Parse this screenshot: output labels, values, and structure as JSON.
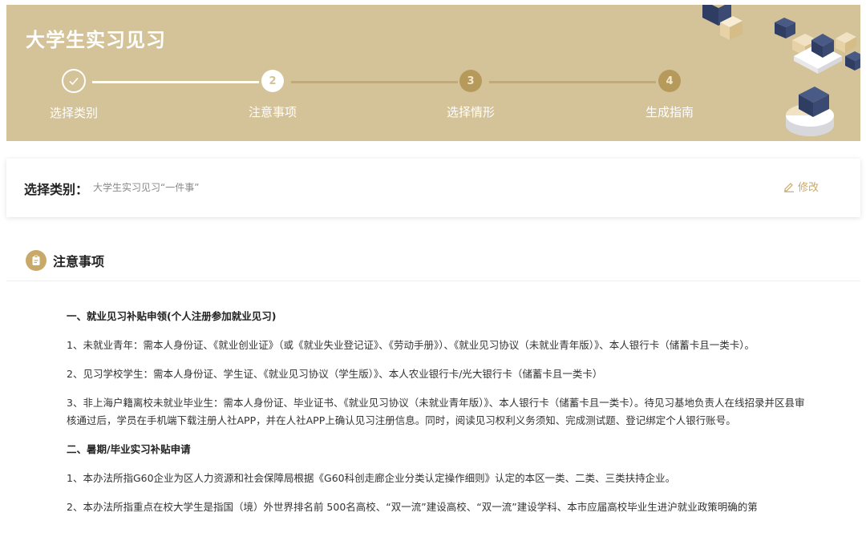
{
  "banner": {
    "title": "大学生实习见习",
    "steps": [
      {
        "number": "",
        "label": "选择类别",
        "state": "done"
      },
      {
        "number": "2",
        "label": "注意事项",
        "state": "active"
      },
      {
        "number": "3",
        "label": "选择情形",
        "state": "pending"
      },
      {
        "number": "4",
        "label": "生成指南",
        "state": "pending"
      }
    ]
  },
  "category_card": {
    "label": "选择类别：",
    "value": "大学生实习见习“一件事”",
    "edit_label": "修改"
  },
  "section": {
    "title": "注意事项",
    "blocks": [
      {
        "type": "heading",
        "text": "一、就业见习补贴申领(个人注册参加就业见习)"
      },
      {
        "type": "para",
        "text": "1、未就业青年：需本人身份证、《就业创业证》（或《就业失业登记证》、《劳动手册》）、《就业见习协议（未就业青年版）》、本人银行卡（储蓄卡且一类卡）。"
      },
      {
        "type": "para",
        "text": "2、见习学校学生：需本人身份证、学生证、《就业见习协议（学生版）》、本人农业银行卡/光大银行卡（储蓄卡且一类卡）"
      },
      {
        "type": "para",
        "text": "3、非上海户籍离校未就业毕业生：需本人身份证、毕业证书、《就业见习协议（未就业青年版）》、本人银行卡（储蓄卡且一类卡）。待见习基地负责人在线招录并区县审核通过后，学员在手机端下载注册人社APP，并在人社APP上确认见习注册信息。同时，阅读见习权利义务须知、完成测试题、登记绑定个人银行账号。"
      },
      {
        "type": "heading",
        "text": "二、暑期/毕业实习补贴申请"
      },
      {
        "type": "para",
        "text": "1、本办法所指G60企业为区人力资源和社会保障局根据《G60科创走廊企业分类认定操作细则》认定的本区一类、二类、三类扶持企业。"
      },
      {
        "type": "para",
        "text": "2、本办法所指重点在校大学生是指国（境）外世界排名前 500名高校、“双一流”建设高校、“双一流”建设学科、本市应届高校毕业生进沪就业政策明确的第"
      }
    ]
  },
  "colors": {
    "banner": "#d4c298",
    "accent": "#c9a96a",
    "navy": "#3b4a72"
  }
}
